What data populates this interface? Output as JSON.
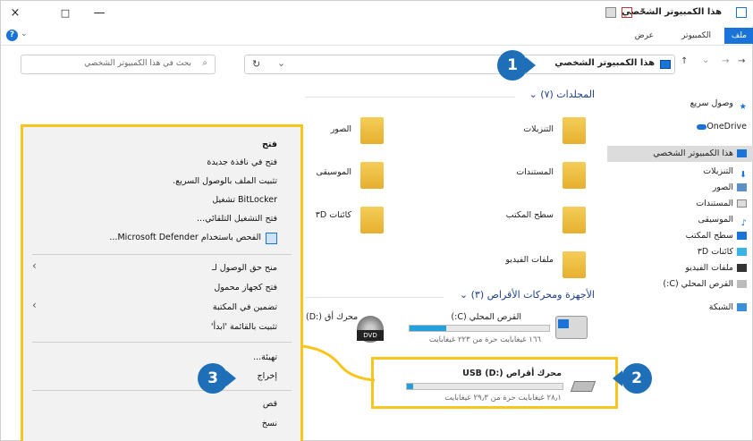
{
  "window": {
    "title": "هذا الكمبيوتر الشخصي",
    "controls": {
      "close": "×",
      "maximize": "□",
      "minimize": "—"
    }
  },
  "ribbon": {
    "tabs": [
      {
        "label": "ملف",
        "active": true
      },
      {
        "label": "الكمبيوتر",
        "active": false
      },
      {
        "label": "عرض",
        "active": false
      }
    ],
    "help": "?"
  },
  "address": {
    "path": "هذا الكمبيوتر الشخصي",
    "search_placeholder": "بحث في هذا الكمبيوتر الشخصي"
  },
  "sidebar": {
    "items": [
      {
        "label": "وصول سريع",
        "icon": "star-icon"
      },
      {
        "label": "OneDrive",
        "icon": "cloud-icon"
      },
      {
        "label": "هذا الكمبيوتر الشخصي",
        "icon": "computer-icon",
        "selected": true
      },
      {
        "label": "التنزيلات",
        "icon": "download-icon"
      },
      {
        "label": "الصور",
        "icon": "pictures-icon"
      },
      {
        "label": "المستندات",
        "icon": "documents-icon"
      },
      {
        "label": "الموسيقى",
        "icon": "music-icon"
      },
      {
        "label": "سطح المكتب",
        "icon": "desktop-icon"
      },
      {
        "label": "كائنات ٣D",
        "icon": "3d-objects-icon"
      },
      {
        "label": "ملفات الفيديو",
        "icon": "video-icon"
      },
      {
        "label": "القرص المحلي (C:)",
        "icon": "drive-icon"
      },
      {
        "label": "الشبكة",
        "icon": "network-icon"
      }
    ]
  },
  "folders_section": {
    "heading": "المجلدات (٧)",
    "folders": [
      {
        "label": "التنزيلات"
      },
      {
        "label": "الصور"
      },
      {
        "label": "المستندات"
      },
      {
        "label": "الموسيقى"
      },
      {
        "label": "سطح المكتب"
      },
      {
        "label": "كائنات ٣D"
      },
      {
        "label": "ملفات الفيديو"
      }
    ]
  },
  "drives_section": {
    "heading": "الأجهزة ومحركات الأقراص (٣)",
    "drives": [
      {
        "label": "القرص المحلي (C:)",
        "free": "١٦٦ غيغابايت حرة من ٢٢٣ غيغابايت",
        "used_fraction": 0.26
      },
      {
        "label": "محرك أقراص USB (D:)",
        "free": "٢٨٫١ غيغابايت حرة من ٢٩٫٣ غيغابايت",
        "used_fraction": 0.04
      },
      {
        "label": "(D:) محرك أق"
      }
    ]
  },
  "context_menu": {
    "groups": [
      [
        "فتح",
        "فتح في نافذة جديدة",
        "تثبيت الملف بالوصول السريع.",
        "تشغيل BitLocker",
        "فتح التشغيل التلقائي...",
        "الفحص باستخدام Microsoft Defender..."
      ],
      [
        "منح حق الوصول لـ",
        "فتح كجهاز محمول",
        "تضمين في المكتبة",
        "تثبيت بالقائمة 'ابدأ'"
      ],
      [
        "تهيئة...",
        "إخراج"
      ],
      [
        "قص",
        "نسخ"
      ]
    ]
  },
  "callouts": {
    "one": "1",
    "two": "2",
    "three": "3"
  },
  "colors": {
    "highlight": "#f8c51c",
    "badge": "#1e6fb8",
    "accent": "#1a73d9",
    "bar_fill": "#26a0da"
  }
}
